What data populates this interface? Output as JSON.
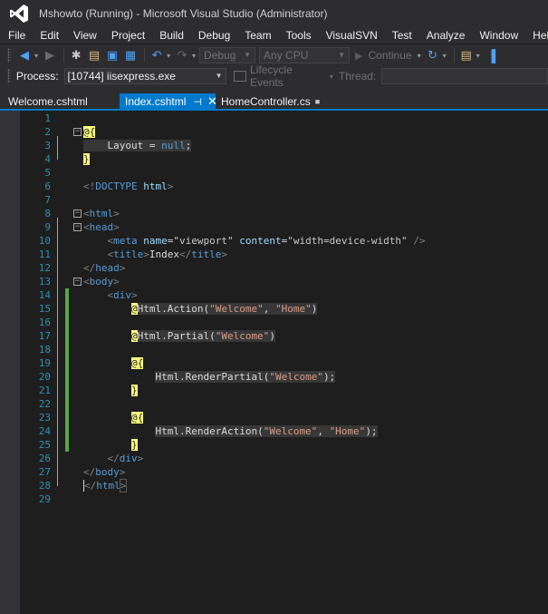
{
  "window": {
    "title": "Mshowto (Running) - Microsoft Visual Studio (Administrator)"
  },
  "menu": [
    "File",
    "Edit",
    "View",
    "Project",
    "Build",
    "Debug",
    "Team",
    "Tools",
    "VisualSVN",
    "Test",
    "Analyze",
    "Window",
    "Help"
  ],
  "toolbar": {
    "configuration": "Debug",
    "platform": "Any CPU",
    "continue_label": "Continue"
  },
  "debugbar": {
    "process_label": "Process:",
    "process_value": "[10744] iisexpress.exe",
    "lifecycle_label": "Lifecycle Events",
    "thread_label": "Thread:"
  },
  "tabs": [
    {
      "label": "Welcome.cshtml",
      "active": false
    },
    {
      "label": "Index.cshtml",
      "active": true
    },
    {
      "label": "HomeController.cs",
      "active": false
    }
  ],
  "editor": {
    "line_numbers": [
      "1",
      "2",
      "3",
      "4",
      "5",
      "6",
      "7",
      "8",
      "9",
      "10",
      "11",
      "12",
      "13",
      "14",
      "15",
      "16",
      "17",
      "18",
      "19",
      "20",
      "21",
      "22",
      "23",
      "24",
      "25",
      "26",
      "27",
      "28",
      "29"
    ],
    "lines": [
      [],
      [
        {
          "t": "@{",
          "c": "tk-delim"
        }
      ],
      [
        {
          "t": "    Layout = ",
          "c": "tk-text tk-rz"
        },
        {
          "t": "null",
          "c": "tk-kw tk-rz"
        },
        {
          "t": ";",
          "c": "tk-text tk-rz"
        }
      ],
      [
        {
          "t": "}",
          "c": "tk-delim"
        }
      ],
      [],
      [
        {
          "t": "<!",
          "c": "tk-punc"
        },
        {
          "t": "DOCTYPE",
          "c": "tk-tag"
        },
        {
          "t": " ",
          "c": "tk-text"
        },
        {
          "t": "html",
          "c": "tk-attr"
        },
        {
          "t": ">",
          "c": "tk-punc"
        }
      ],
      [],
      [
        {
          "t": "<",
          "c": "tk-punc"
        },
        {
          "t": "html",
          "c": "tk-tag"
        },
        {
          "t": ">",
          "c": "tk-punc"
        }
      ],
      [
        {
          "t": "<",
          "c": "tk-punc"
        },
        {
          "t": "head",
          "c": "tk-tag"
        },
        {
          "t": ">",
          "c": "tk-punc"
        }
      ],
      [
        {
          "t": "    <",
          "c": "tk-punc"
        },
        {
          "t": "meta",
          "c": "tk-tag"
        },
        {
          "t": " ",
          "c": "tk-text"
        },
        {
          "t": "name",
          "c": "tk-attr"
        },
        {
          "t": "=",
          "c": "tk-eq"
        },
        {
          "t": "\"viewport\"",
          "c": "tk-val"
        },
        {
          "t": " ",
          "c": "tk-text"
        },
        {
          "t": "content",
          "c": "tk-attr"
        },
        {
          "t": "=",
          "c": "tk-eq"
        },
        {
          "t": "\"width=device-width\"",
          "c": "tk-val"
        },
        {
          "t": " />",
          "c": "tk-punc"
        }
      ],
      [
        {
          "t": "    <",
          "c": "tk-punc"
        },
        {
          "t": "title",
          "c": "tk-tag"
        },
        {
          "t": ">",
          "c": "tk-punc"
        },
        {
          "t": "Index",
          "c": "tk-text"
        },
        {
          "t": "</",
          "c": "tk-punc"
        },
        {
          "t": "title",
          "c": "tk-tag"
        },
        {
          "t": ">",
          "c": "tk-punc"
        }
      ],
      [
        {
          "t": "</",
          "c": "tk-punc"
        },
        {
          "t": "head",
          "c": "tk-tag"
        },
        {
          "t": ">",
          "c": "tk-punc"
        }
      ],
      [
        {
          "t": "<",
          "c": "tk-punc"
        },
        {
          "t": "body",
          "c": "tk-tag"
        },
        {
          "t": ">",
          "c": "tk-punc"
        }
      ],
      [
        {
          "t": "    <",
          "c": "tk-punc"
        },
        {
          "t": "div",
          "c": "tk-tag"
        },
        {
          "t": ">",
          "c": "tk-punc"
        }
      ],
      [
        {
          "t": "        ",
          "c": "tk-text"
        },
        {
          "t": "@",
          "c": "tk-delim"
        },
        {
          "t": "Html.Action(",
          "c": "tk-razor tk-rz"
        },
        {
          "t": "\"Welcome\"",
          "c": "tk-str tk-rz"
        },
        {
          "t": ", ",
          "c": "tk-rpunc tk-rz"
        },
        {
          "t": "\"Home\"",
          "c": "tk-str tk-rz"
        },
        {
          "t": ")",
          "c": "tk-rpunc tk-rz"
        }
      ],
      [],
      [
        {
          "t": "        ",
          "c": "tk-text"
        },
        {
          "t": "@",
          "c": "tk-delim"
        },
        {
          "t": "Html.Partial(",
          "c": "tk-razor tk-rz"
        },
        {
          "t": "\"Welcome\"",
          "c": "tk-str tk-rz"
        },
        {
          "t": ")",
          "c": "tk-rpunc tk-rz"
        }
      ],
      [],
      [
        {
          "t": "        ",
          "c": "tk-text"
        },
        {
          "t": "@{",
          "c": "tk-delim"
        }
      ],
      [
        {
          "t": "            ",
          "c": "tk-text"
        },
        {
          "t": "Html.RenderPartial(",
          "c": "tk-razor tk-rz"
        },
        {
          "t": "\"Welcome\"",
          "c": "tk-str tk-rz"
        },
        {
          "t": ");",
          "c": "tk-rpunc tk-rz"
        }
      ],
      [
        {
          "t": "        ",
          "c": "tk-text"
        },
        {
          "t": "}",
          "c": "tk-delim"
        }
      ],
      [],
      [
        {
          "t": "        ",
          "c": "tk-text"
        },
        {
          "t": "@{",
          "c": "tk-delim"
        }
      ],
      [
        {
          "t": "            ",
          "c": "tk-text"
        },
        {
          "t": "Html.RenderAction(",
          "c": "tk-razor tk-rz"
        },
        {
          "t": "\"Welcome\"",
          "c": "tk-str tk-rz"
        },
        {
          "t": ", ",
          "c": "tk-rpunc tk-rz"
        },
        {
          "t": "\"Home\"",
          "c": "tk-str tk-rz"
        },
        {
          "t": ");",
          "c": "tk-rpunc tk-rz"
        }
      ],
      [
        {
          "t": "        ",
          "c": "tk-text"
        },
        {
          "t": "}",
          "c": "tk-delim"
        }
      ],
      [
        {
          "t": "    </",
          "c": "tk-punc"
        },
        {
          "t": "div",
          "c": "tk-tag"
        },
        {
          "t": ">",
          "c": "tk-punc"
        }
      ],
      [
        {
          "t": "</",
          "c": "tk-punc"
        },
        {
          "t": "body",
          "c": "tk-tag"
        },
        {
          "t": ">",
          "c": "tk-punc"
        }
      ],
      [
        {
          "t": "</",
          "c": "tk-punc tk-cursor"
        },
        {
          "t": "html",
          "c": "tk-tag"
        },
        {
          "t": ">",
          "c": "tk-punc tk-boxed"
        }
      ],
      []
    ],
    "changed_lines": [
      14,
      15,
      16,
      17,
      18,
      19,
      20,
      21,
      22,
      23,
      24,
      25
    ],
    "fold_lines": [
      2,
      8,
      9,
      13
    ]
  },
  "colors": {
    "accent": "#007acc",
    "background": "#1e1e1e",
    "chrome": "#2d2d30",
    "line_number": "#2b91af",
    "change_bar": "#57a64a"
  }
}
